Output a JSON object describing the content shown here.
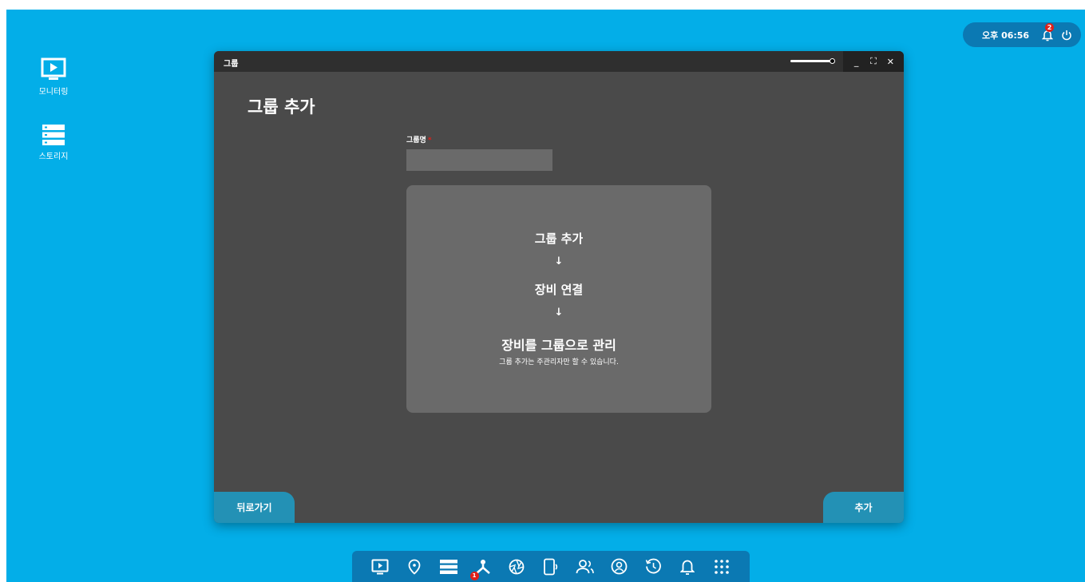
{
  "desktop": {
    "icons": [
      {
        "label": "모니터링",
        "icon": "monitor-play-icon"
      },
      {
        "label": "스토리지",
        "icon": "storage-icon"
      }
    ]
  },
  "status": {
    "time": "오후 06:56",
    "notification_count": "2",
    "icons": [
      "bell-icon",
      "power-icon"
    ]
  },
  "window": {
    "title": "그룹",
    "controls": [
      "_",
      "⛶",
      "✕"
    ],
    "page_title": "그룹 추가",
    "field_label": "그룹명",
    "required_mark": "*",
    "group_name_value": "",
    "info": {
      "step1": "그룹 추가",
      "arrow": "↓",
      "step2": "장비 연결",
      "step3": "장비를 그룹으로 관리",
      "note": "그룹 추가는 주관리자만 할 수 있습니다."
    },
    "back_label": "뒤로가기",
    "add_label": "추가"
  },
  "taskbar": {
    "items": [
      {
        "icon": "monitor-play-icon"
      },
      {
        "icon": "location-pin-icon"
      },
      {
        "icon": "storage-icon"
      },
      {
        "icon": "group-network-icon",
        "badge": "1"
      },
      {
        "icon": "camera-aperture-icon"
      },
      {
        "icon": "device-icon"
      },
      {
        "icon": "users-icon"
      },
      {
        "icon": "user-circle-icon"
      },
      {
        "icon": "history-icon"
      },
      {
        "icon": "bell-icon"
      },
      {
        "icon": "apps-grid-icon"
      }
    ]
  },
  "colors": {
    "desktop_bg": "#03aee8",
    "accent": "#2391b5",
    "window_bg": "#4a4a4a",
    "badge": "#e0201a"
  }
}
